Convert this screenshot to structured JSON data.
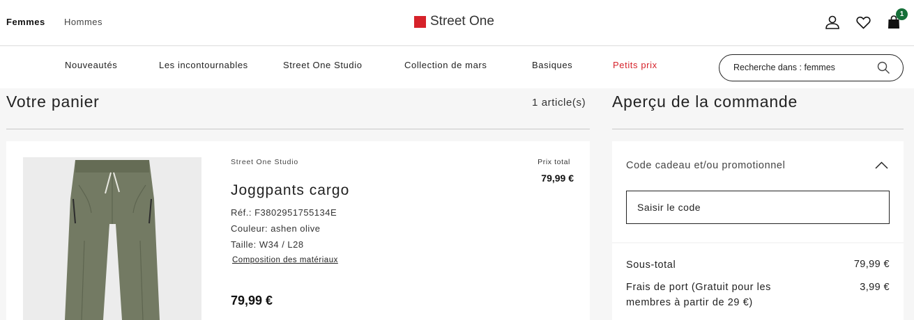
{
  "header": {
    "genders": [
      "Femmes",
      "Hommes"
    ],
    "logo": "Street One",
    "cart_count": "1",
    "colors": {
      "brand_red": "#d6222a",
      "badge_green": "#156f38"
    }
  },
  "nav": {
    "items": [
      "Nouveautés",
      "Les incontournables",
      "Street One Studio",
      "Collection de mars",
      "Basiques",
      "Petits prix"
    ],
    "search_placeholder": "Recherche dans : femmes"
  },
  "cart": {
    "title": "Votre panier",
    "count": "1 article(s)",
    "item": {
      "brand": "Street One Studio",
      "name": "Joggpants cargo",
      "ref": "Réf.: F3802951755134E",
      "color": "Couleur: ashen olive",
      "size": "Taille: W34 / L28",
      "materials_link": "Composition des matériaux",
      "price": "79,99 €",
      "total_label": "Prix total",
      "total": "79,99 €"
    }
  },
  "summary": {
    "title": "Aperçu de la commande",
    "promo_label": "Code cadeau et/ou promotionnel",
    "code_placeholder": "Saisir le code",
    "subtotal_label": "Sous-total",
    "subtotal": "79,99 €",
    "shipping_label_line1": "Frais de port (Gratuit pour les",
    "shipping_label_line2": "membres à partir de 29 €)",
    "shipping": "3,99 €"
  }
}
